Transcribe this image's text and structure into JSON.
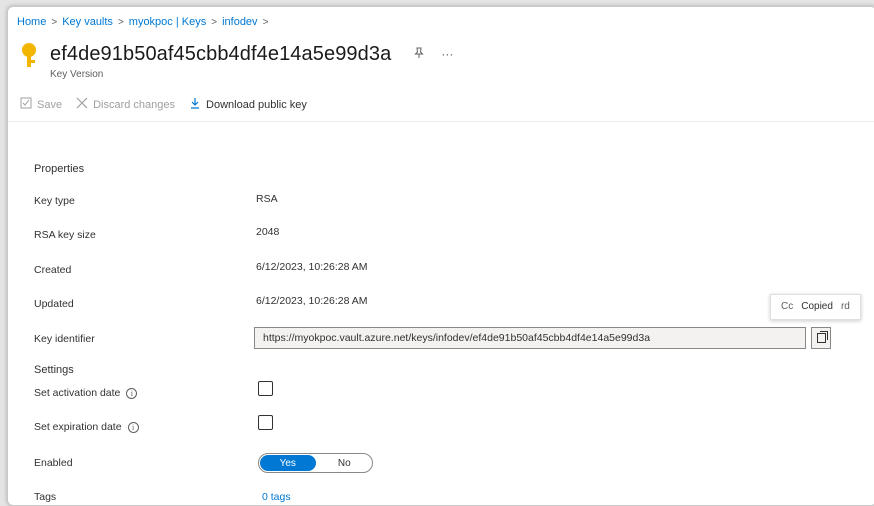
{
  "breadcrumb": {
    "items": [
      "Home",
      "Key vaults",
      "myokpoc | Keys",
      "infodev"
    ],
    "separator": ">"
  },
  "header": {
    "title": "ef4de91b50af45cbb4df4e14a5e99d3a",
    "subtitle": "Key Version",
    "pin_icon": "pin-icon",
    "more_label": "···"
  },
  "toolbar": {
    "save_label": "Save",
    "discard_label": "Discard changes",
    "download_label": "Download public key"
  },
  "properties": {
    "heading": "Properties",
    "key_type_label": "Key type",
    "key_type_value": "RSA",
    "key_size_label": "RSA key size",
    "key_size_value": "2048",
    "created_label": "Created",
    "created_value": "6/12/2023, 10:26:28 AM",
    "updated_label": "Updated",
    "updated_value": "6/12/2023, 10:26:28 AM",
    "key_identifier_label": "Key identifier",
    "key_identifier_value": "https://myokpoc.vault.azure.net/keys/infodev/ef4de91b50af45cbb4df4e14a5e99d3a"
  },
  "tooltip": {
    "left_fragment": "Cc",
    "text": "Copied",
    "right_fragment": "rd"
  },
  "settings": {
    "heading": "Settings",
    "activation_label": "Set activation date",
    "expiration_label": "Set expiration date",
    "enabled_label": "Enabled",
    "toggle_yes": "Yes",
    "toggle_no": "No",
    "enabled_value": "Yes",
    "activation_checked": false,
    "expiration_checked": false
  },
  "tags": {
    "label": "Tags",
    "link": "0 tags"
  },
  "colors": {
    "accent": "#0078d4",
    "key_icon": "#f2b600"
  }
}
